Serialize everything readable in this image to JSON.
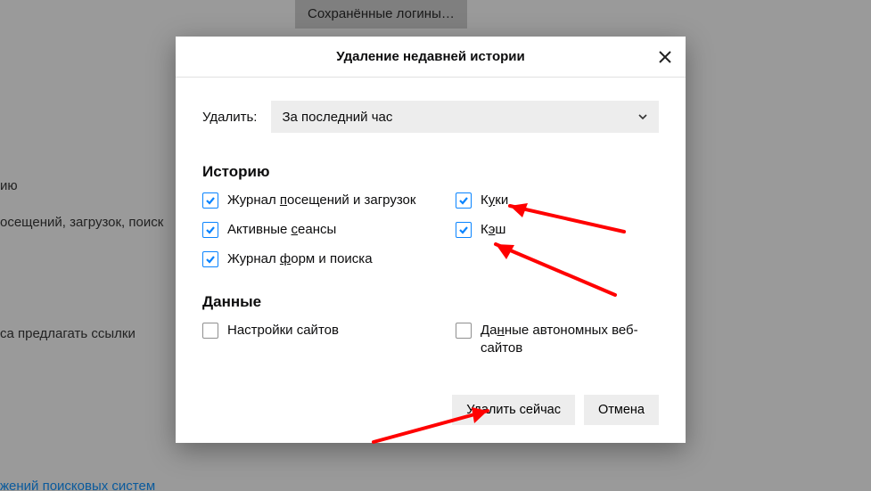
{
  "background": {
    "saved_logins_button": "Сохранённые логины…",
    "frag1": "ию",
    "frag2": "осещений, загрузок, поиск",
    "frag3": "са предлагать ссылки",
    "frag4": "жений поисковых систем"
  },
  "dialog": {
    "title": "Удаление недавней истории",
    "range_label": "Удалить:",
    "range_value": "За последний час",
    "section_history": "Историю",
    "section_data": "Данные",
    "checks": {
      "browsing_downloads": {
        "label_pre": "Журнал ",
        "label_u": "п",
        "label_post": "осещений и загрузок",
        "checked": true
      },
      "cookies": {
        "label_pre": "К",
        "label_u": "у",
        "label_post": "ки",
        "checked": true
      },
      "active_logins": {
        "label_pre": "Активные ",
        "label_u": "с",
        "label_post": "еансы",
        "checked": true
      },
      "cache": {
        "label_pre": "К",
        "label_u": "э",
        "label_post": "ш",
        "checked": true
      },
      "form_search": {
        "label_pre": "Журнал ",
        "label_u": "ф",
        "label_post": "орм и поиска",
        "checked": true
      },
      "site_prefs": {
        "label_pre": "Настройки сайтов",
        "label_u": "",
        "label_post": "",
        "checked": false
      },
      "offline_data": {
        "label_pre": "Да",
        "label_u": "н",
        "label_post": "ные автономных веб-сайтов",
        "checked": false
      }
    },
    "buttons": {
      "clear_now": "Удалить сейчас",
      "cancel": "Отмена"
    }
  }
}
